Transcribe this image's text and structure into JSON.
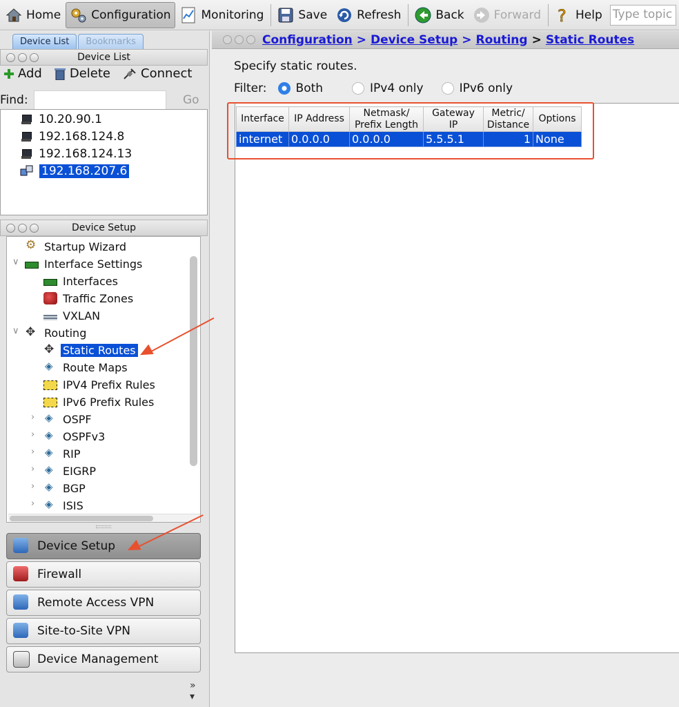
{
  "toolbar": {
    "home": "Home",
    "configuration": "Configuration",
    "monitoring": "Monitoring",
    "save": "Save",
    "refresh": "Refresh",
    "back": "Back",
    "forward": "Forward",
    "help": "Help",
    "search_placeholder": "Type topic"
  },
  "left_tabs": {
    "device_list": "Device List",
    "bookmarks": "Bookmarks"
  },
  "device_list_panel": {
    "title": "Device List",
    "add": "Add",
    "delete": "Delete",
    "connect": "Connect",
    "find_label": "Find:",
    "go": "Go",
    "devices": [
      "10.20.90.1",
      "192.168.124.8",
      "192.168.124.13",
      "192.168.207.6"
    ],
    "selected_device": "192.168.207.6"
  },
  "device_setup_panel": {
    "title": "Device Setup",
    "tree": [
      "Startup Wizard",
      "Interface Settings",
      "Interfaces",
      "Traffic Zones",
      "VXLAN",
      "Routing",
      "Static Routes",
      "Route Maps",
      "IPV4 Prefix Rules",
      "IPv6 Prefix Rules",
      "OSPF",
      "OSPFv3",
      "RIP",
      "EIGRP",
      "BGP",
      "ISIS"
    ],
    "selected_item": "Static Routes"
  },
  "nav_buttons": [
    "Device Setup",
    "Firewall",
    "Remote Access VPN",
    "Site-to-Site VPN",
    "Device Management"
  ],
  "breadcrumb": {
    "configuration": "Configuration",
    "device_setup": "Device Setup",
    "routing": "Routing",
    "current": "Static Routes",
    "sep": ">"
  },
  "main": {
    "hint": "Specify static routes.",
    "filter_label": "Filter:",
    "filter_options": [
      "Both",
      "IPv4 only",
      "IPv6 only"
    ],
    "filter_selected": "Both",
    "columns": [
      "Interface",
      "IP Address",
      "Netmask/ Prefix Length",
      "Gateway IP",
      "Metric/ Distance",
      "Options"
    ],
    "rows": [
      [
        "internet",
        "0.0.0.0",
        "0.0.0.0",
        "5.5.5.1",
        "1",
        "None"
      ]
    ]
  },
  "colors": {
    "selection": "#0a50d6",
    "annotation": "#e8502e",
    "link": "#1a1ad6"
  }
}
